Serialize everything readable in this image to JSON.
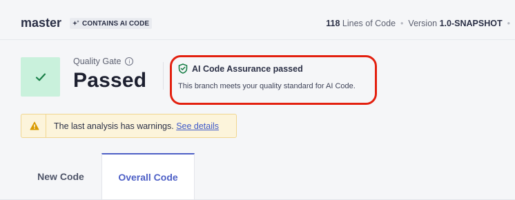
{
  "header": {
    "branch": "master",
    "ai_badge": "CONTAINS AI CODE",
    "lines_count": "118",
    "lines_label": "Lines of Code",
    "version_label": "Version",
    "version_value": "1.0-SNAPSHOT"
  },
  "quality_gate": {
    "label": "Quality Gate",
    "status": "Passed"
  },
  "ai_assurance": {
    "title": "AI Code Assurance passed",
    "description": "This branch meets your quality standard for AI Code."
  },
  "warning": {
    "text": "The last analysis has warnings.",
    "link": "See details"
  },
  "tabs": [
    {
      "label": "New Code"
    },
    {
      "label": "Overall Code"
    }
  ],
  "colors": {
    "accent": "#4d5fc6",
    "passed_bg": "#c9f1dc",
    "passed_check": "#1a7f48",
    "highlight": "#e3200f",
    "warning_bg": "#fcf4db",
    "warning_icon": "#d99b00"
  }
}
